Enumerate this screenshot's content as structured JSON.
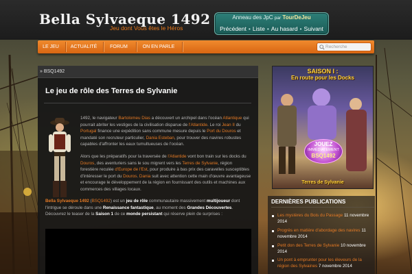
{
  "header": {
    "site_title": "Bella Sylvaeque 1492",
    "tagline": "Jeu dont Vous êtes le Héros"
  },
  "ring": {
    "title_pre": "Anneau des JpC",
    "title_par": "par",
    "title_brand": "TourDeJeu",
    "links": [
      "Précédent",
      "Liste",
      "Au hasard",
      "Suivant"
    ],
    "sep": "•"
  },
  "nav": {
    "items": [
      "LE JEU",
      "ACTUALITÉ",
      "FORUM",
      "ON EN PARLE"
    ]
  },
  "search": {
    "placeholder": "Recherche"
  },
  "breadcrumb": {
    "text": "» BSQ1492"
  },
  "post": {
    "title": "Le jeu de rôle des Terres de Sylvanie",
    "p1": [
      {
        "t": "1492, le navigateur ",
        "s": ""
      },
      {
        "t": "Bartolomeu Dias",
        "s": "o"
      },
      {
        "t": " a découvert un archipel dans l'océan ",
        "s": ""
      },
      {
        "t": "Atlantique",
        "s": "o"
      },
      {
        "t": " qui pourrait abriter les vestiges de la civilisation disparue de ",
        "s": ""
      },
      {
        "t": "l'Atlantide",
        "s": "o"
      },
      {
        "t": ". Le roi ",
        "s": ""
      },
      {
        "t": "Jean II",
        "s": "o"
      },
      {
        "t": " du ",
        "s": ""
      },
      {
        "t": "Portugal",
        "s": "o"
      },
      {
        "t": " finance une expédition sans commune mesure depuis le ",
        "s": ""
      },
      {
        "t": "Port du Douros",
        "s": "o"
      },
      {
        "t": " et mandaté son recruteur particulier, ",
        "s": ""
      },
      {
        "t": "Dania Esteban",
        "s": "o"
      },
      {
        "t": ", pour trouver des navires robustes capables d'affronter les eaux tumultueuses de l'océan.",
        "s": ""
      }
    ],
    "p2": [
      {
        "t": "Alors que les préparatifs pour la traversée de ",
        "s": ""
      },
      {
        "t": "l'Atlantide",
        "s": "o"
      },
      {
        "t": " vont bon train sur les docks du ",
        "s": ""
      },
      {
        "t": "Douros",
        "s": "o"
      },
      {
        "t": ", des aventuriers sans le sou migrent vers les ",
        "s": ""
      },
      {
        "t": "Terres de Sylvanie",
        "s": "o"
      },
      {
        "t": ", région forestière reculée ",
        "s": ""
      },
      {
        "t": "d'Europe de l'Est",
        "s": "o"
      },
      {
        "t": ", pour produire à bas prix des caravelles susceptibles d'intéresser le port du ",
        "s": ""
      },
      {
        "t": "Douros",
        "s": "o"
      },
      {
        "t": ". ",
        "s": ""
      },
      {
        "t": "Dania",
        "s": "o"
      },
      {
        "t": " suit avec attention cette main d'œuvre avantageuse et encourage le développement de la région en fournissant des outils et machines aux commerces des villages locaux.",
        "s": ""
      }
    ],
    "p3": [
      {
        "t": "Bella Sylvaeque 1492",
        "s": "bo"
      },
      {
        "t": " (",
        "s": ""
      },
      {
        "t": "BSQ1492",
        "s": "o"
      },
      {
        "t": ") est un ",
        "s": ""
      },
      {
        "t": "jeu de rôle",
        "s": "b"
      },
      {
        "t": " communautaire massivement ",
        "s": ""
      },
      {
        "t": "multijoueur",
        "s": "b"
      },
      {
        "t": " dont l'intrigue se déroule dans une ",
        "s": ""
      },
      {
        "t": "Renaissance fantastique",
        "s": "b"
      },
      {
        "t": ", au moment des ",
        "s": ""
      },
      {
        "t": "Grandes Découvertes",
        "s": "b"
      },
      {
        "t": ". Découvrez le teaser de la ",
        "s": ""
      },
      {
        "t": "Saison 1",
        "s": "b"
      },
      {
        "t": " de ce ",
        "s": ""
      },
      {
        "t": "monde persistant",
        "s": "b"
      },
      {
        "t": " qui réserve plein de surprises :",
        "s": ""
      }
    ]
  },
  "promo": {
    "title1": "SAISON I :",
    "title2": "En route pour les Docks",
    "badge1": "JOUEZ",
    "badge2": "IMMÉDIATEMENT",
    "badge3": "BSQ1492",
    "footer": "Terres de Sylvanie"
  },
  "recent": {
    "heading": "DERNIÈRES PUBLICATIONS",
    "items": [
      {
        "title": "Les mystères du Bois du Passage",
        "date": "11 novembre 2014"
      },
      {
        "title": "Progrès en matière d'abordage des navires",
        "date": "11 novembre 2014"
      },
      {
        "title": "Petit don des Terres de Sylvanie",
        "date": "10 novembre 2014"
      },
      {
        "title": "Un pont à emprunter pour les éleveurs de la région des Sylvaines",
        "date": "7 novembre 2014"
      }
    ]
  },
  "colors": {
    "accent": "#e57a25",
    "nav": "#e0741c",
    "ring": "#2a7a74"
  }
}
